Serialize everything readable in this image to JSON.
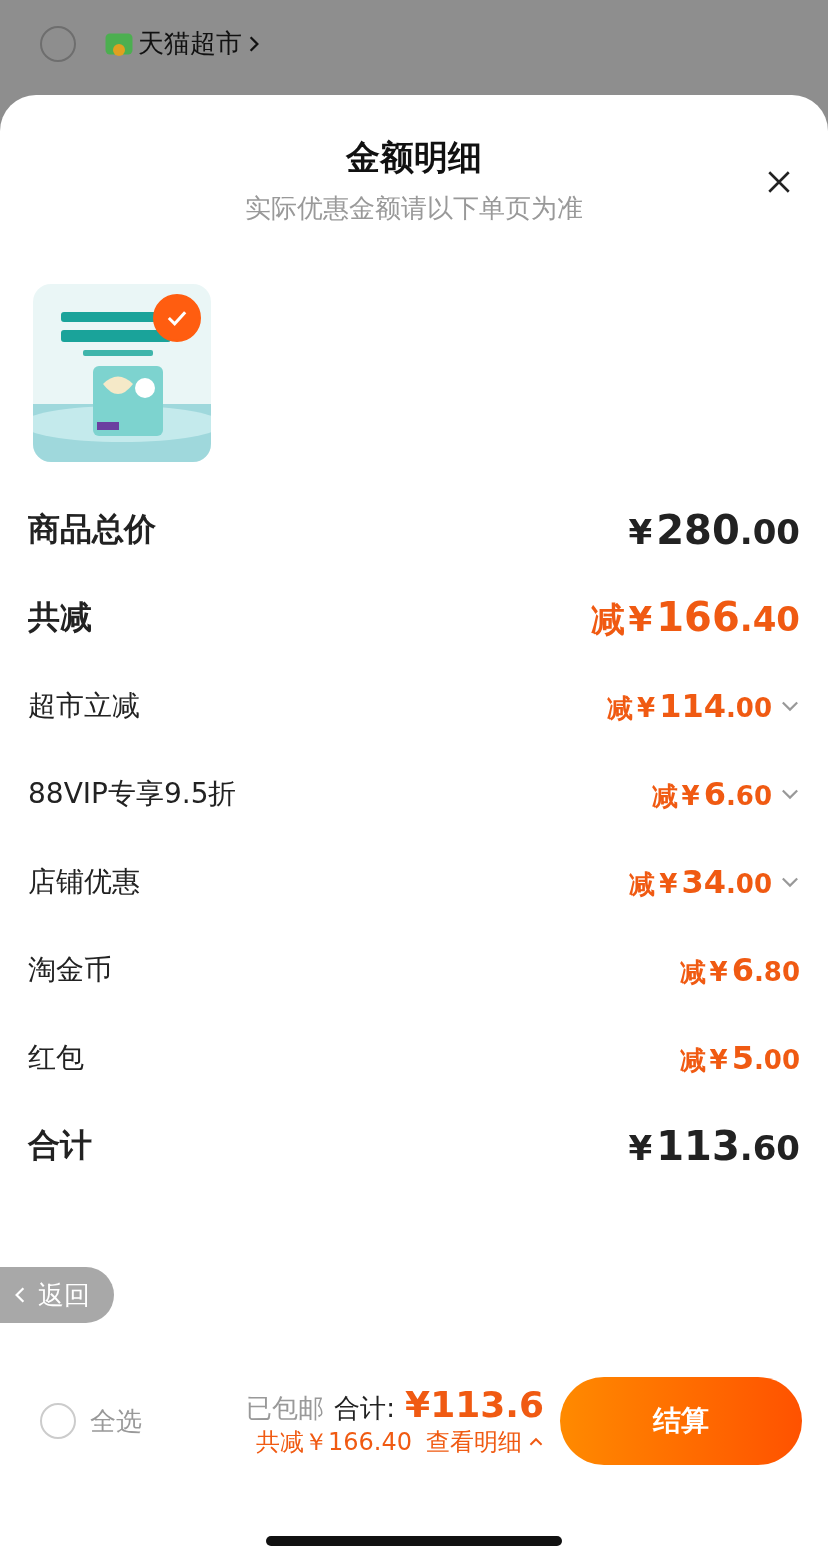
{
  "store_header": {
    "selected": false,
    "store_name": "天猫超市"
  },
  "sheet": {
    "title": "金额明细",
    "subtitle": "实际优惠金额请以下单页为准"
  },
  "product": {
    "selected": true
  },
  "rows": [
    {
      "kind": "total",
      "label": "商品总价",
      "prefix": "",
      "currency": "¥",
      "integer": "280",
      "decimal": ".00",
      "expandable": false
    },
    {
      "kind": "discount_total",
      "label": "共减",
      "prefix": "减",
      "currency": "¥",
      "integer": "166",
      "decimal": ".40",
      "expandable": false
    },
    {
      "kind": "discount",
      "label": "超市立减",
      "prefix": "减",
      "currency": "¥",
      "integer": "114",
      "decimal": ".00",
      "expandable": true
    },
    {
      "kind": "discount",
      "label": "88VIP专享9.5折",
      "prefix": "减",
      "currency": "¥",
      "integer": "6",
      "decimal": ".60",
      "expandable": true
    },
    {
      "kind": "discount",
      "label": "店铺优惠",
      "prefix": "减",
      "currency": "¥",
      "integer": "34",
      "decimal": ".00",
      "expandable": true
    },
    {
      "kind": "discount",
      "label": "淘金币",
      "prefix": "减",
      "currency": "¥",
      "integer": "6",
      "decimal": ".80",
      "expandable": false
    },
    {
      "kind": "discount",
      "label": "红包",
      "prefix": "减",
      "currency": "¥",
      "integer": "5",
      "decimal": ".00",
      "expandable": false
    },
    {
      "kind": "total",
      "label": "合计",
      "prefix": "",
      "currency": "¥",
      "integer": "113",
      "decimal": ".60",
      "expandable": false
    }
  ],
  "back_button": {
    "label": "返回"
  },
  "bottom_bar": {
    "select_all": {
      "label": "全选",
      "checked": false
    },
    "shipping": "已包邮",
    "total_label": "合计:",
    "total_amount": "¥113.6",
    "discount_note": "共减￥166.40",
    "details_link": "查看明细",
    "checkout_button": "结算"
  }
}
